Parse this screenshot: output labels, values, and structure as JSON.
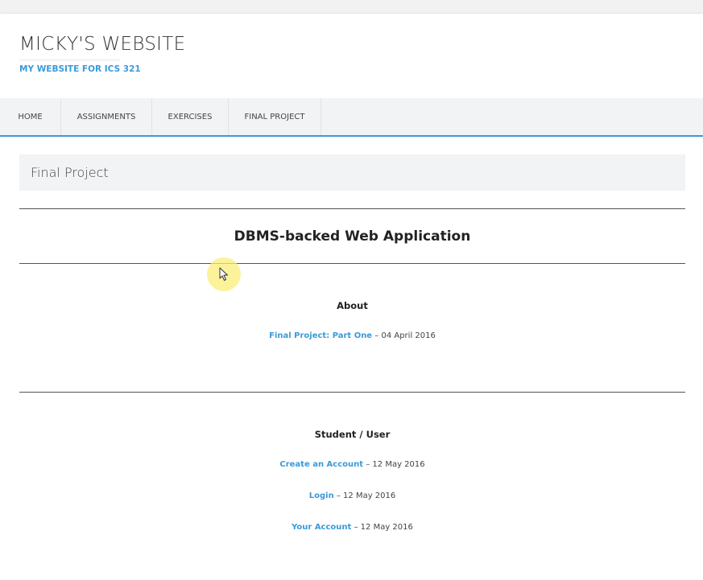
{
  "site": {
    "title": "MICKY'S WEBSITE",
    "description": "MY WEBSITE FOR ICS 321"
  },
  "nav": {
    "items": [
      {
        "label": "HOME"
      },
      {
        "label": "ASSIGNMENTS"
      },
      {
        "label": "EXERCISES"
      },
      {
        "label": "FINAL PROJECT"
      }
    ]
  },
  "page": {
    "header": "Final Project",
    "main_heading": "DBMS-backed Web Application"
  },
  "sections": [
    {
      "heading": "About",
      "entries": [
        {
          "link": "Final Project: Part One",
          "date": "– 04 April 2016"
        }
      ]
    },
    {
      "heading": "Student / User",
      "entries": [
        {
          "link": "Create an Account",
          "date": "– 12 May 2016"
        },
        {
          "link": "Login",
          "date": "– 12 May 2016"
        },
        {
          "link": "Your Account",
          "date": "– 12 May 2016"
        }
      ]
    }
  ],
  "colors": {
    "accent": "#3a9ad9",
    "cursor_highlight": "#faee78"
  },
  "icons": {
    "cursor": "mouse-pointer-icon"
  }
}
